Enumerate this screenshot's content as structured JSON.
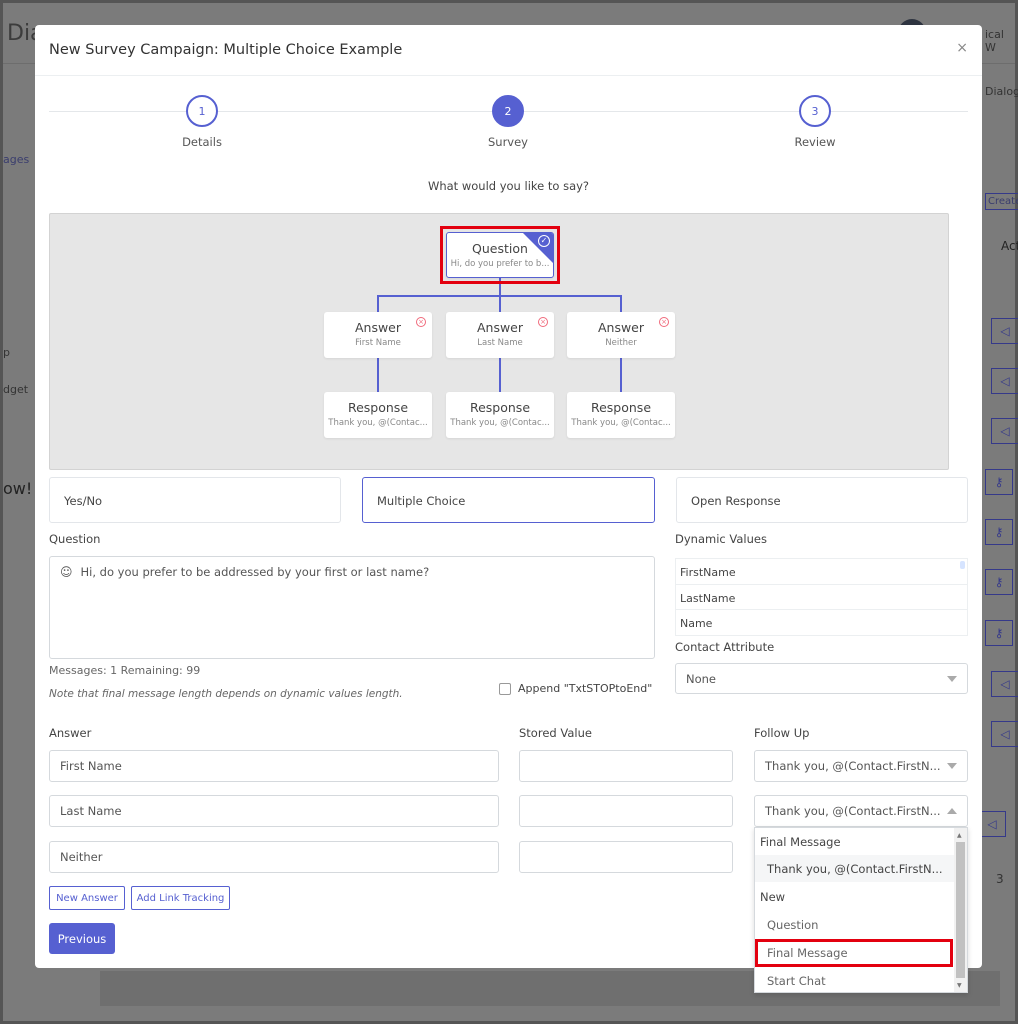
{
  "background": {
    "app_title_fragment": "Dia",
    "nav_fragments": [
      "ages",
      "p",
      "dget",
      "ow!"
    ],
    "user_fragment": "ical W",
    "right_fragments": {
      "dialog": "Dialog",
      "create": "Create",
      "actions": "Act",
      "page_number": "3"
    }
  },
  "modal": {
    "title": "New Survey Campaign: Multiple Choice Example",
    "close_label": "×",
    "steps": [
      {
        "number": "1",
        "label": "Details",
        "state": "complete"
      },
      {
        "number": "2",
        "label": "Survey",
        "state": "active"
      },
      {
        "number": "3",
        "label": "Review",
        "state": "pending"
      }
    ],
    "prompt": "What would you like to say?",
    "flow": {
      "question": {
        "title": "Question",
        "subtitle": "Hi, do you prefer to b..."
      },
      "answers": [
        {
          "title": "Answer",
          "subtitle": "First Name"
        },
        {
          "title": "Answer",
          "subtitle": "Last Name"
        },
        {
          "title": "Answer",
          "subtitle": "Neither"
        }
      ],
      "responses": [
        {
          "title": "Response",
          "subtitle": "Thank you, @(Contac..."
        },
        {
          "title": "Response",
          "subtitle": "Thank you, @(Contac..."
        },
        {
          "title": "Response",
          "subtitle": "Thank you, @(Contac..."
        }
      ]
    },
    "types": [
      "Yes/No",
      "Multiple Choice",
      "Open Response"
    ],
    "selected_type": "Multiple Choice",
    "question_label": "Question",
    "question_text": "Hi, do you prefer to be addressed by your first or last name?",
    "messages_info": "Messages: 1 Remaining: 99",
    "note": "Note that final message length depends on dynamic values length.",
    "append_label": "Append \"TxtSTOPtoEnd\"",
    "append_checked": false,
    "dynamic_values_label": "Dynamic Values",
    "dynamic_values": [
      "FirstName",
      "LastName",
      "Name"
    ],
    "contact_attribute_label": "Contact Attribute",
    "contact_attribute_value": "None",
    "answer_header": "Answer",
    "stored_value_header": "Stored Value",
    "follow_up_header": "Follow Up",
    "answer_rows": [
      {
        "answer": "First Name",
        "stored_value": "",
        "follow_up": "Thank you, @(Contact.FirstN..."
      },
      {
        "answer": "Last Name",
        "stored_value": "",
        "follow_up": "Thank you, @(Contact.FirstN..."
      },
      {
        "answer": "Neither",
        "stored_value": ""
      }
    ],
    "new_answer_label": "New Answer",
    "add_link_tracking_label": "Add Link Tracking",
    "previous_label": "Previous",
    "dropdown": {
      "groups": [
        {
          "label": "Final Message",
          "options": [
            "Thank you, @(Contact.FirstN..."
          ]
        },
        {
          "label": "New",
          "options": [
            "Question",
            "Final Message",
            "Start Chat"
          ]
        }
      ],
      "highlighted": "Final Message"
    }
  },
  "colors": {
    "accent": "#5660d1",
    "highlight_box": "#e3000f",
    "remove_icon": "#f06a7c"
  }
}
